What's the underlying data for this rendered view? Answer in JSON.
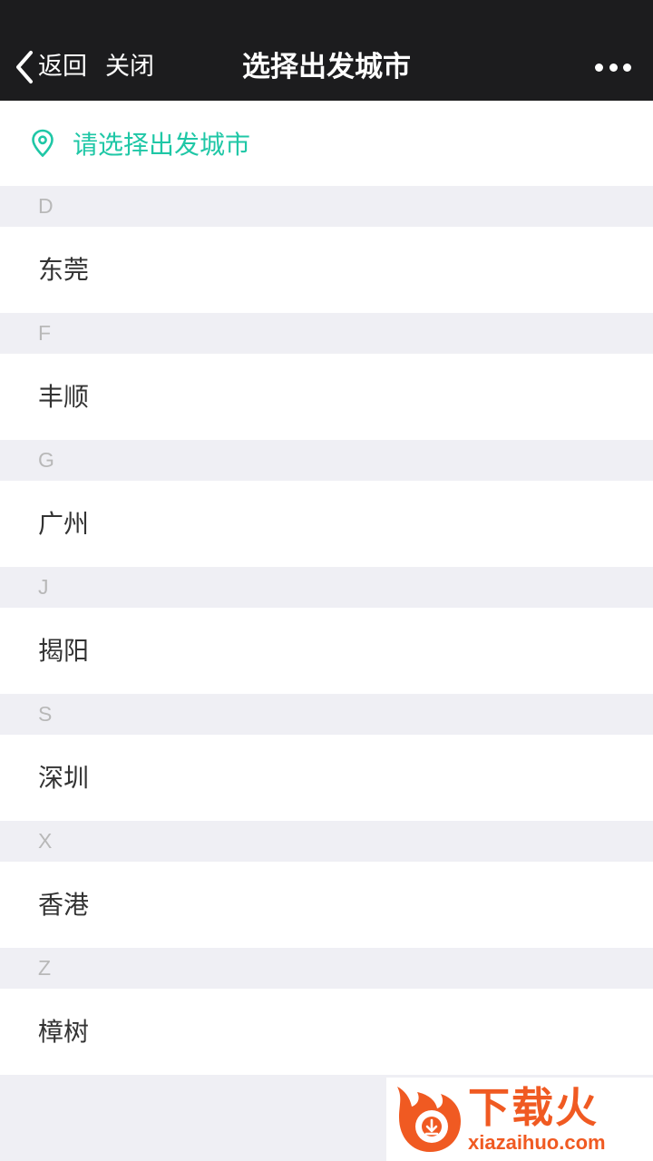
{
  "navbar": {
    "back_label": "返回",
    "close_label": "关闭",
    "title": "选择出发城市",
    "more_icon": "more-dots-icon"
  },
  "locate": {
    "icon": "location-pin-icon",
    "label": "请选择出发城市",
    "color": "#1fc7a6"
  },
  "groups": [
    {
      "letter": "D",
      "cities": [
        "东莞"
      ]
    },
    {
      "letter": "F",
      "cities": [
        "丰顺"
      ]
    },
    {
      "letter": "G",
      "cities": [
        "广州"
      ]
    },
    {
      "letter": "J",
      "cities": [
        "揭阳"
      ]
    },
    {
      "letter": "S",
      "cities": [
        "深圳"
      ]
    },
    {
      "letter": "X",
      "cities": [
        "香港"
      ]
    },
    {
      "letter": "Z",
      "cities": [
        "樟树"
      ]
    }
  ],
  "watermark": {
    "brand_cn": "下载火",
    "brand_en": "xiazaihuo.com",
    "color": "#f05a22"
  }
}
